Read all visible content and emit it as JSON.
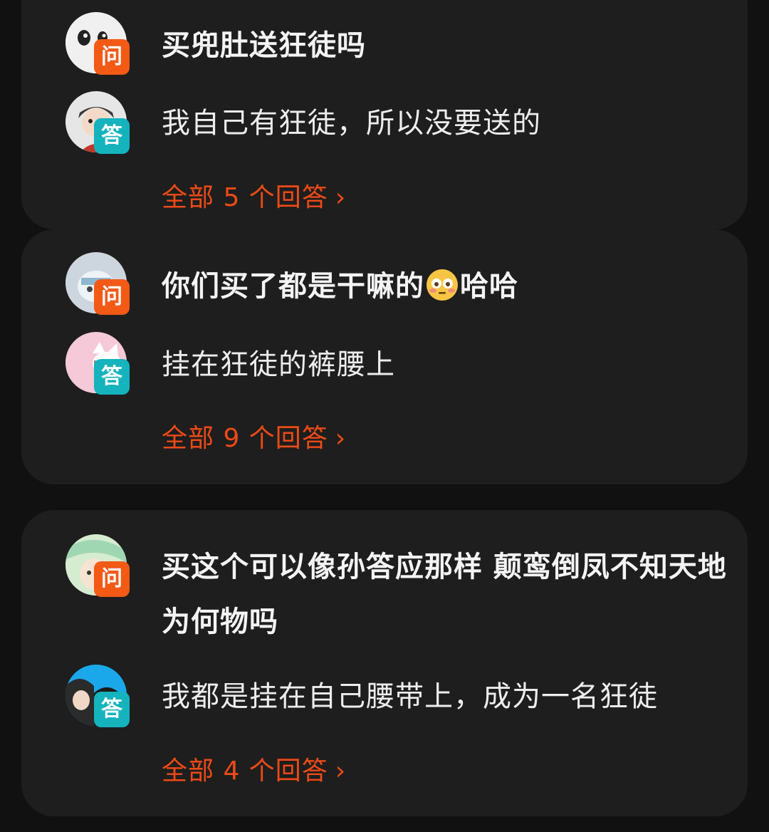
{
  "badges": {
    "question": "问",
    "answer": "答"
  },
  "colors": {
    "accent_orange": "#ee4a16",
    "question_badge": "#f25a16",
    "answer_badge": "#14b3be",
    "card_bg": "#1e1e1e",
    "page_bg": "#111111"
  },
  "items": [
    {
      "question": "买兜肚送狂徒吗",
      "answer": "我自己有狂徒，所以没要送的",
      "all_answers": "全部 5 个回答",
      "chevron_icon": "chevron-right-icon"
    },
    {
      "question_before": "你们买了都是干嘛的",
      "question_emoji": "flushed-face-emoji",
      "question_after": "哈哈",
      "answer": "挂在狂徒的裤腰上",
      "all_answers": "全部 9 个回答",
      "chevron_icon": "chevron-right-icon"
    },
    {
      "question": "买这个可以像孙答应那样 颠鸾倒凤不知天地为何物吗",
      "answer": "我都是挂在自己腰带上，成为一名狂徒",
      "all_answers": "全部 4 个回答",
      "chevron_icon": "chevron-right-icon"
    }
  ],
  "chevron": "›"
}
